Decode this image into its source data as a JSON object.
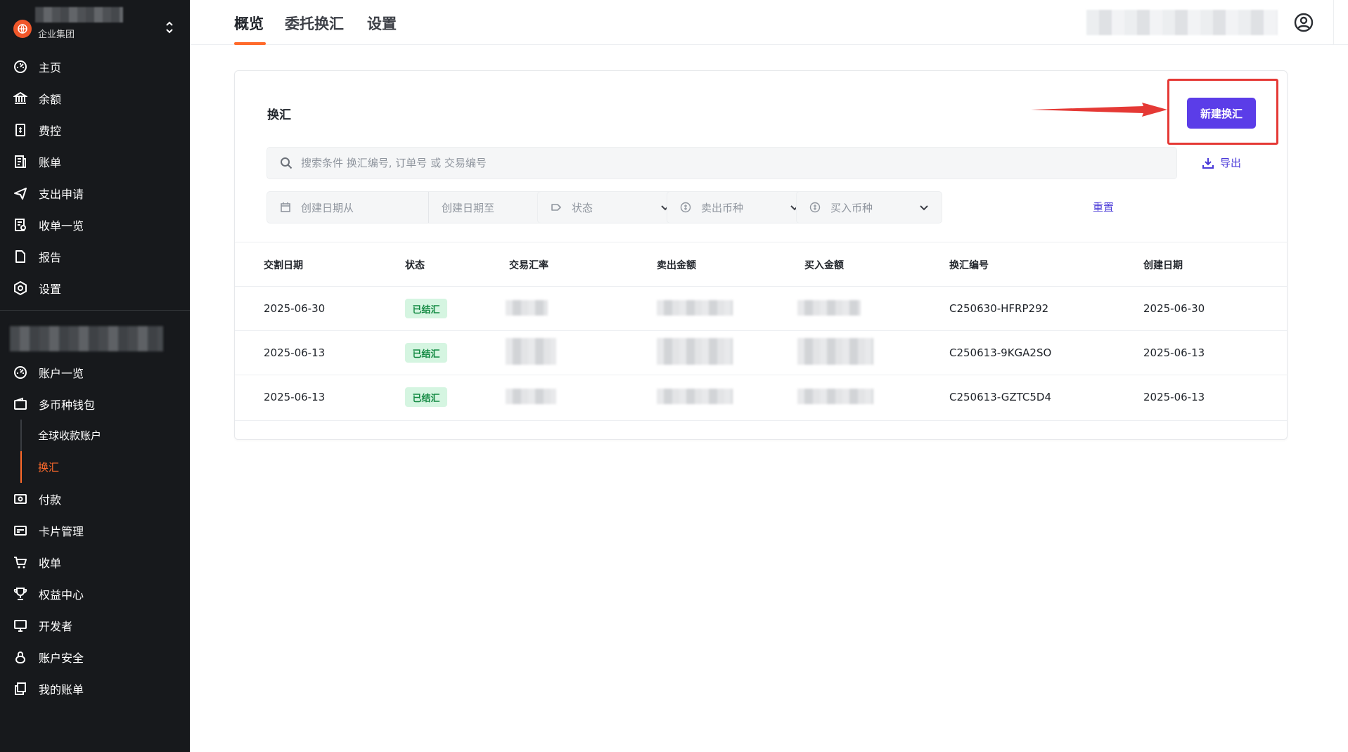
{
  "sidebar": {
    "org_subtitle": "企业集团",
    "main_items": [
      {
        "label": "主页",
        "icon": "dashboard-icon"
      },
      {
        "label": "余额",
        "icon": "bank-icon"
      },
      {
        "label": "费控",
        "icon": "expense-icon"
      },
      {
        "label": "账单",
        "icon": "bill-icon"
      },
      {
        "label": "支出申请",
        "icon": "send-icon"
      },
      {
        "label": "收单一览",
        "icon": "receipt-list-icon"
      },
      {
        "label": "报告",
        "icon": "document-icon"
      },
      {
        "label": "设置",
        "icon": "settings-icon"
      }
    ],
    "account_items": [
      {
        "label": "账户一览",
        "icon": "dashboard-icon"
      },
      {
        "label": "多币种钱包",
        "icon": "wallet-icon"
      }
    ],
    "wallet_sub_items": [
      {
        "label": "全球收款账户",
        "active": false
      },
      {
        "label": "换汇",
        "active": true
      }
    ],
    "more_items": [
      {
        "label": "付款",
        "icon": "payment-icon"
      },
      {
        "label": "卡片管理",
        "icon": "card-icon"
      },
      {
        "label": "收单",
        "icon": "cart-icon"
      },
      {
        "label": "权益中心",
        "icon": "trophy-icon"
      },
      {
        "label": "开发者",
        "icon": "monitor-icon"
      },
      {
        "label": "账户安全",
        "icon": "lock-icon"
      },
      {
        "label": "我的账单",
        "icon": "copy-icon"
      }
    ]
  },
  "topbar": {
    "tabs": [
      {
        "label": "概览",
        "active": true
      },
      {
        "label": "委托换汇",
        "active": false
      },
      {
        "label": "设置",
        "active": false
      }
    ]
  },
  "card": {
    "title": "换汇",
    "new_button": "新建换汇",
    "export_label": "导出",
    "search_placeholder": "搜索条件 换汇编号, 订单号 或 交易编号",
    "filters": {
      "date_from": "创建日期从",
      "date_to": "创建日期至",
      "status": "状态",
      "sell_currency": "卖出币种",
      "buy_currency": "买入币种",
      "reset": "重置"
    },
    "columns": [
      "交割日期",
      "状态",
      "交易汇率",
      "卖出金额",
      "买入金额",
      "换汇编号",
      "创建日期"
    ],
    "rows": [
      {
        "delivery_date": "2025-06-30",
        "status": "已结汇",
        "fx_id": "C250630-HFRP292",
        "created": "2025-06-30"
      },
      {
        "delivery_date": "2025-06-13",
        "status": "已结汇",
        "fx_id": "C250613-9KGA2SO",
        "created": "2025-06-13"
      },
      {
        "delivery_date": "2025-06-13",
        "status": "已结汇",
        "fx_id": "C250613-GZTC5D4",
        "created": "2025-06-13"
      }
    ]
  },
  "colors": {
    "accent_orange": "#ff6a2b",
    "primary_purple": "#5b3de8",
    "annotation_red": "#e53935",
    "badge_green_bg": "#d5f5e1",
    "badge_green_text": "#148a43",
    "sidebar_bg": "#17191c"
  }
}
